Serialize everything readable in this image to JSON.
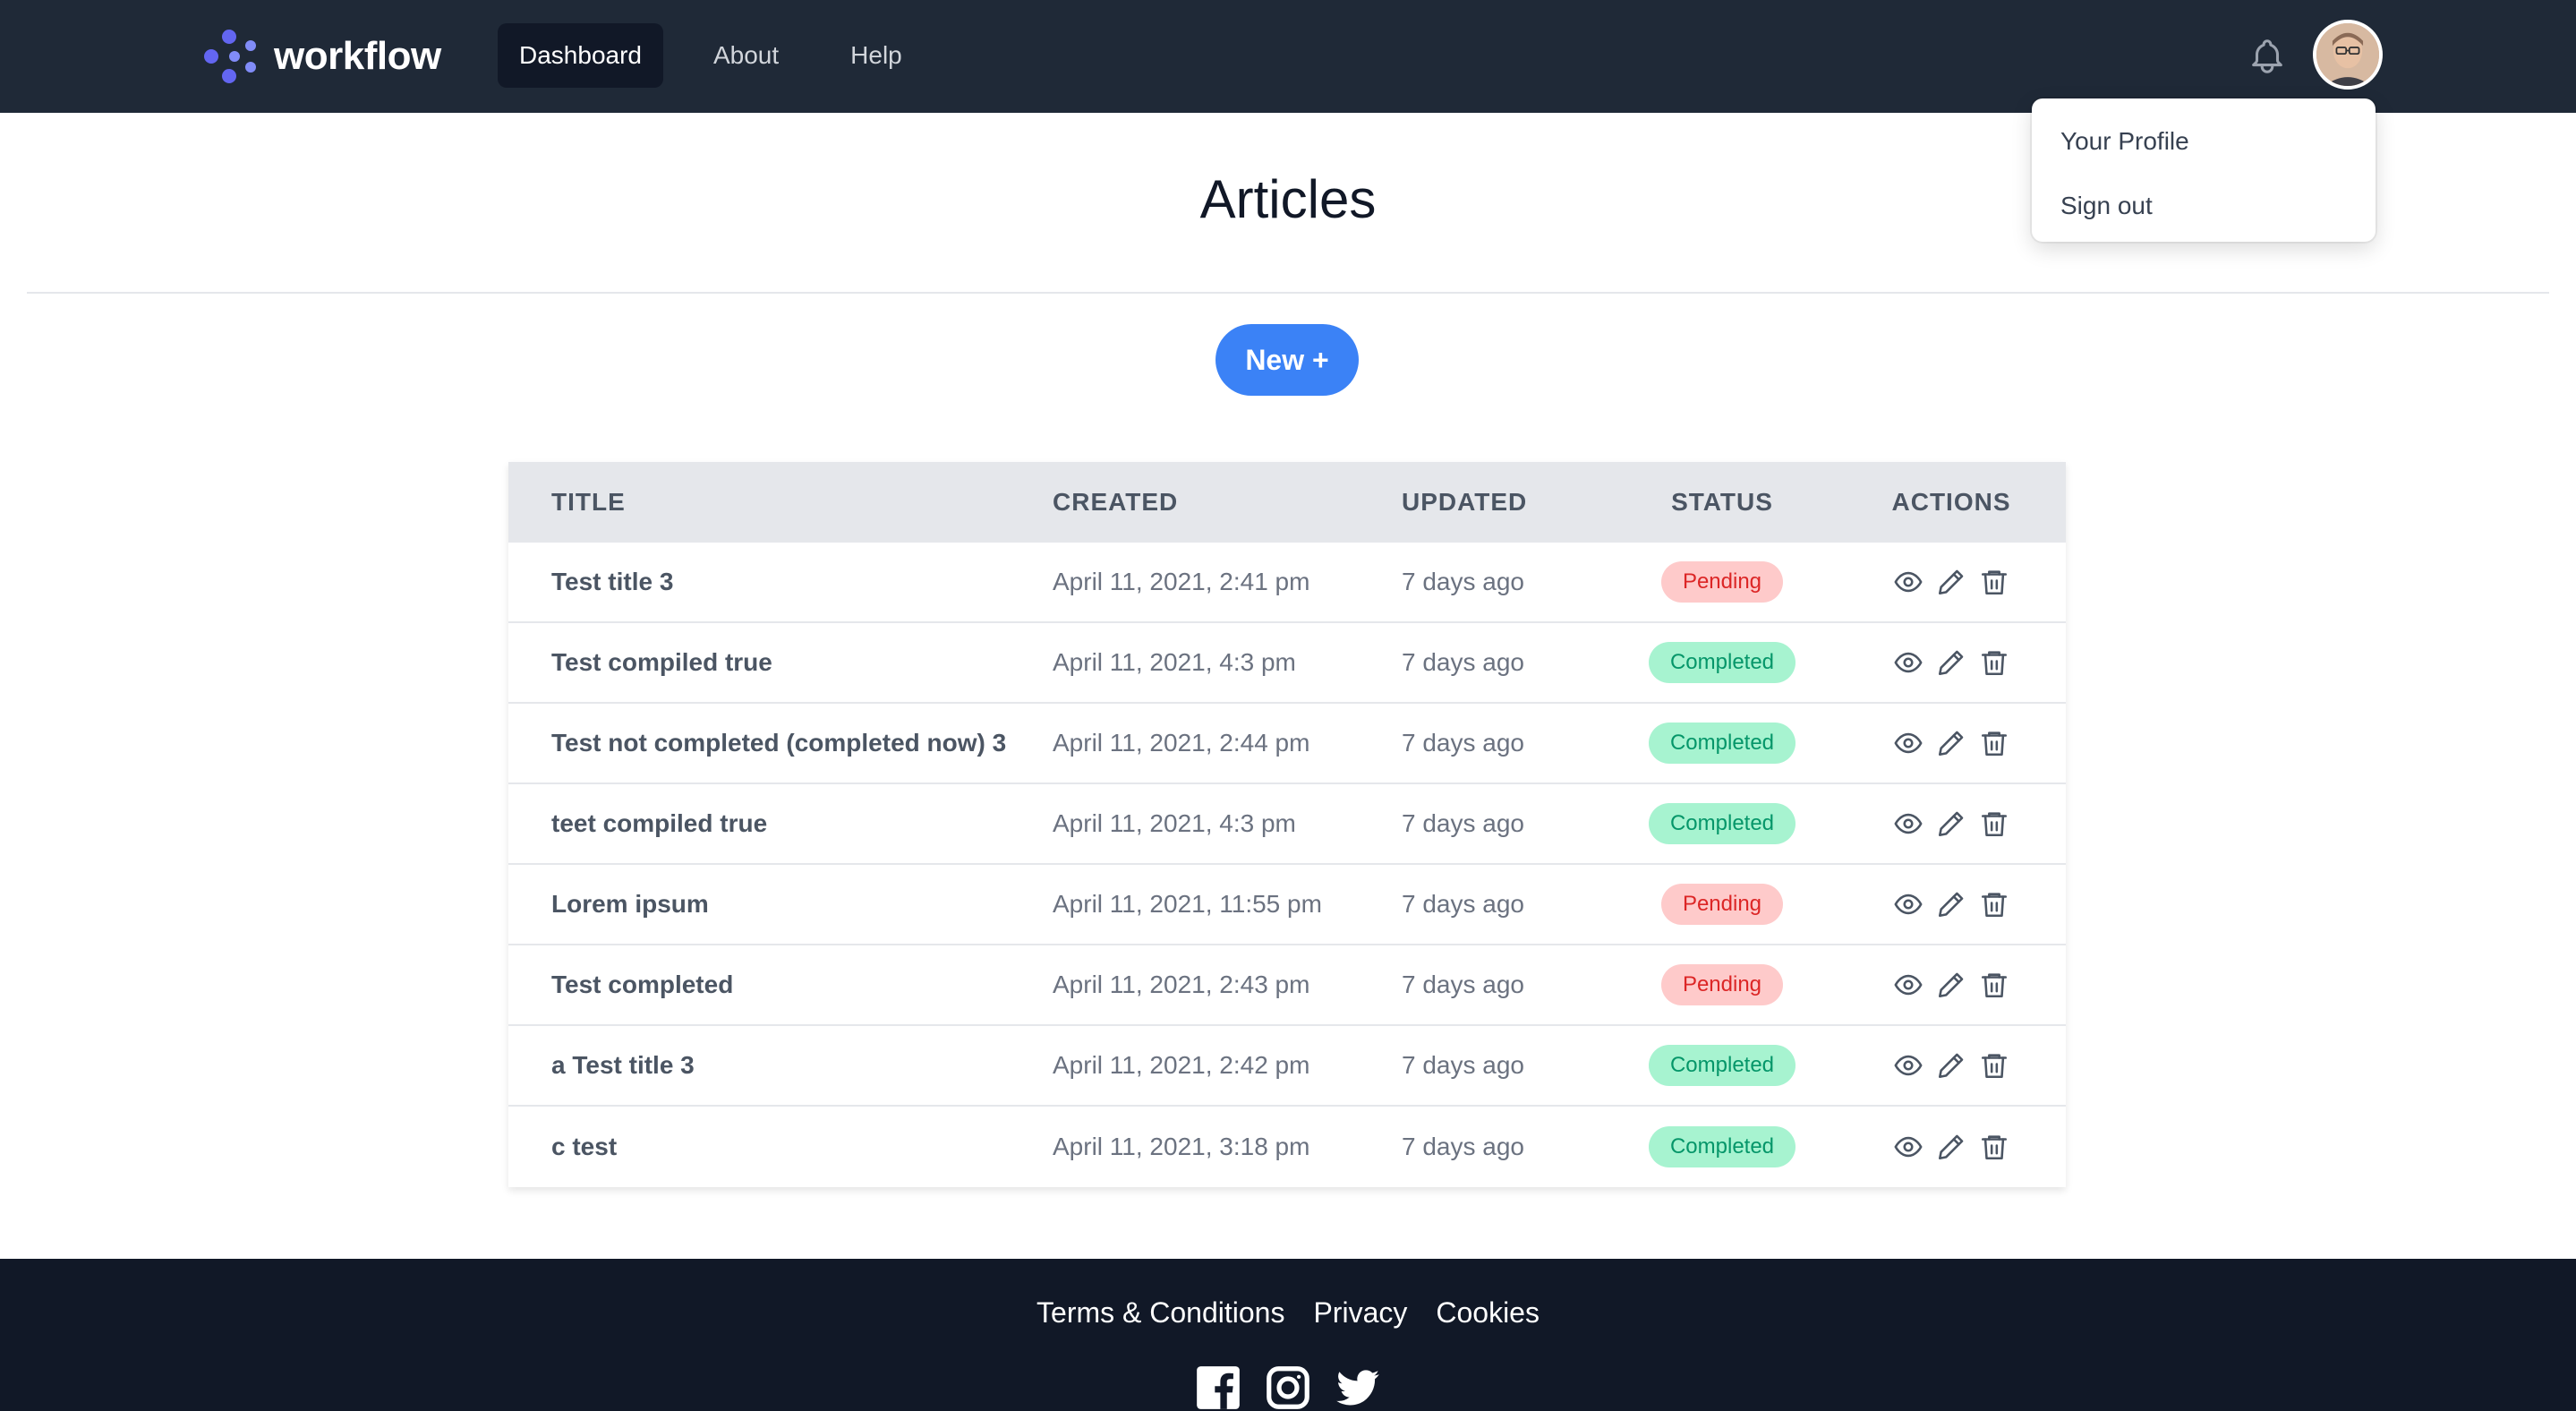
{
  "brand": {
    "name": "workflow",
    "logo_color": "#6366f1"
  },
  "nav": {
    "items": [
      {
        "label": "Dashboard",
        "active": true
      },
      {
        "label": "About",
        "active": false
      },
      {
        "label": "Help",
        "active": false
      }
    ]
  },
  "user_menu": {
    "items": [
      {
        "label": "Your Profile"
      },
      {
        "label": "Sign out"
      }
    ]
  },
  "page": {
    "title": "Articles",
    "new_button_label": "New +"
  },
  "table": {
    "headers": [
      "TITLE",
      "CREATED",
      "UPDATED",
      "STATUS",
      "ACTIONS"
    ],
    "rows": [
      {
        "title": "Test title 3",
        "created": "April 11, 2021, 2:41 pm",
        "updated": "7 days ago",
        "status": "Pending"
      },
      {
        "title": "Test compiled true",
        "created": "April 11, 2021, 4:3 pm",
        "updated": "7 days ago",
        "status": "Completed"
      },
      {
        "title": "Test not completed (completed now) 3",
        "created": "April 11, 2021, 2:44 pm",
        "updated": "7 days ago",
        "status": "Completed"
      },
      {
        "title": "teet compiled true",
        "created": "April 11, 2021, 4:3 pm",
        "updated": "7 days ago",
        "status": "Completed"
      },
      {
        "title": "Lorem ipsum",
        "created": "April 11, 2021, 11:55 pm",
        "updated": "7 days ago",
        "status": "Pending"
      },
      {
        "title": "Test completed",
        "created": "April 11, 2021, 2:43 pm",
        "updated": "7 days ago",
        "status": "Pending"
      },
      {
        "title": "a Test title 3",
        "created": "April 11, 2021, 2:42 pm",
        "updated": "7 days ago",
        "status": "Completed"
      },
      {
        "title": "c test",
        "created": "April 11, 2021, 3:18 pm",
        "updated": "7 days ago",
        "status": "Completed"
      }
    ],
    "row_actions": [
      "eye-icon",
      "pencil-icon",
      "trash-icon"
    ]
  },
  "footer": {
    "links": [
      {
        "label": "Terms & Conditions"
      },
      {
        "label": "Privacy"
      },
      {
        "label": "Cookies"
      }
    ],
    "social": [
      "facebook-icon",
      "instagram-icon",
      "twitter-icon"
    ]
  },
  "colors": {
    "navbar": "#1f2937",
    "footer": "#111827",
    "accent": "#3b82f6",
    "pending_bg": "#fecaca",
    "pending_text": "#dc2626",
    "completed_bg": "#a7f3d0",
    "completed_text": "#059669"
  }
}
